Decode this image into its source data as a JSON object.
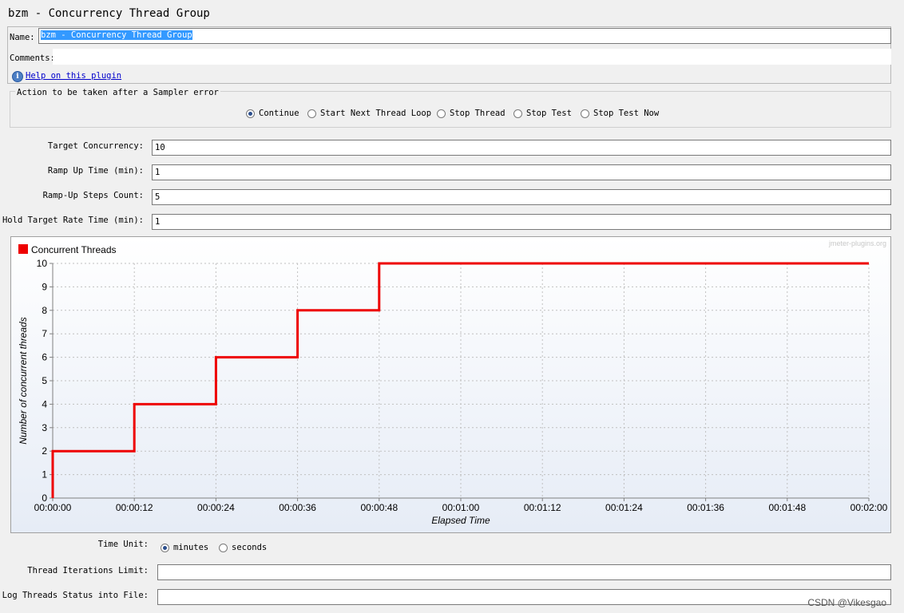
{
  "window": {
    "title": "bzm - Concurrency Thread Group"
  },
  "name_section": {
    "name_label": "Name:",
    "name_value": "bzm - Concurrency Thread Group",
    "comments_label": "Comments:",
    "comments_value": "",
    "help_link": "Help on this plugin",
    "help_icon": "info-icon"
  },
  "sampler_error": {
    "legend": "Action to be taken after a Sampler error",
    "options": [
      {
        "label": "Continue",
        "selected": true
      },
      {
        "label": "Start Next Thread Loop",
        "selected": false
      },
      {
        "label": "Stop Thread",
        "selected": false
      },
      {
        "label": "Stop Test",
        "selected": false
      },
      {
        "label": "Stop Test Now",
        "selected": false
      }
    ]
  },
  "fields": {
    "target_concurrency": {
      "label": "Target Concurrency:",
      "value": "10"
    },
    "ramp_up_time": {
      "label": "Ramp Up Time (min):",
      "value": "1"
    },
    "ramp_up_steps": {
      "label": "Ramp-Up Steps Count:",
      "value": "5"
    },
    "hold_time": {
      "label": "Hold Target Rate Time (min):",
      "value": "1"
    }
  },
  "chart_data": {
    "type": "line",
    "step": true,
    "credit": "jmeter-plugins.org",
    "legend": "top-left",
    "series": [
      {
        "name": "Concurrent Threads",
        "color": "#ee0000",
        "x": [
          0,
          0,
          12,
          12,
          24,
          24,
          36,
          36,
          48,
          48,
          120
        ],
        "y": [
          0,
          2,
          2,
          4,
          4,
          6,
          6,
          8,
          8,
          10,
          10
        ]
      }
    ],
    "xlabel": "Elapsed Time",
    "ylabel": "Number of concurrent threads",
    "xlim": [
      0,
      120
    ],
    "ylim": [
      0,
      10
    ],
    "xticks": [
      0,
      12,
      24,
      36,
      48,
      60,
      72,
      84,
      96,
      108,
      120
    ],
    "xtick_labels": [
      "00:00:00",
      "00:00:12",
      "00:00:24",
      "00:00:36",
      "00:00:48",
      "00:01:00",
      "00:01:12",
      "00:01:24",
      "00:01:36",
      "00:01:48",
      "00:02:00"
    ],
    "yticks": [
      0,
      1,
      2,
      3,
      4,
      5,
      6,
      7,
      8,
      9,
      10
    ],
    "grid": true
  },
  "time_unit": {
    "label": "Time Unit:",
    "options": [
      {
        "label": "minutes",
        "selected": true
      },
      {
        "label": "seconds",
        "selected": false
      }
    ]
  },
  "iterations": {
    "label": "Thread Iterations Limit:",
    "value": ""
  },
  "log_file": {
    "label": "Log Threads Status into File:",
    "value": ""
  },
  "watermark": "CSDN @Vikesgao"
}
